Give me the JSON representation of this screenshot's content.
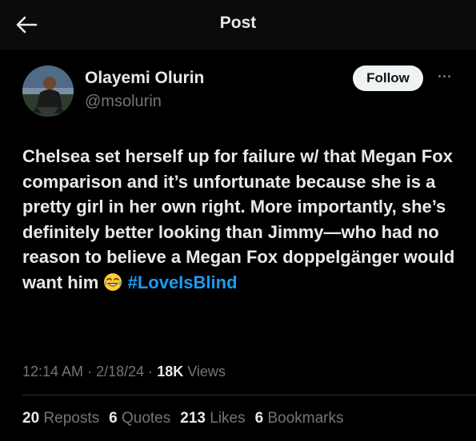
{
  "header": {
    "title": "Post",
    "back_icon": "arrow-left-icon"
  },
  "author": {
    "display_name": "Olayemi Olurin",
    "handle": "@msolurin",
    "avatar": "avatar"
  },
  "actions": {
    "follow_label": "Follow",
    "more_icon": "ellipsis-icon"
  },
  "post": {
    "text": "Chelsea set herself up for failure w/ that Megan Fox comparison and it’s unfortunate because she is a pretty girl in her own right. More importantly, she’s definitely better looking than Jimmy—who had no reason to believe a Megan Fox doppelgänger would want him",
    "emoji": "laughing-crying-emoji",
    "hashtag": "#LoveIsBlind"
  },
  "meta": {
    "time": "12:14 AM",
    "separator": "·",
    "date": "2/18/24",
    "views_count": "18K",
    "views_label": "Views"
  },
  "stats": {
    "reposts_count": "20",
    "reposts_label": "Reposts",
    "quotes_count": "6",
    "quotes_label": "Quotes",
    "likes_count": "213",
    "likes_label": "Likes",
    "bookmarks_count": "6",
    "bookmarks_label": "Bookmarks"
  },
  "colors": {
    "background": "#000000",
    "text_primary": "#e7e9ea",
    "text_secondary": "#71767b",
    "link": "#1d9bf0",
    "follow_bg": "#eff3f4"
  }
}
